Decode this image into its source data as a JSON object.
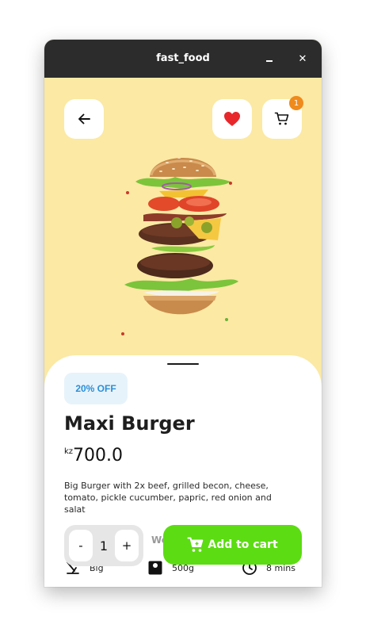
{
  "window": {
    "title": "fast_food"
  },
  "header": {
    "cart_count": "1"
  },
  "product": {
    "discount": "20% OFF",
    "name": "Maxi Burger",
    "currency": "kz",
    "price": "700.0",
    "description": "Big Burger with 2x beef, grilled becon, cheese, tomato, pickle cucumber, papric, red onion and salat",
    "weight_label": "We",
    "specs": {
      "size": "Big",
      "weight": "500g",
      "time": "8 mins"
    }
  },
  "quantity": {
    "minus": "-",
    "value": "1",
    "plus": "+"
  },
  "actions": {
    "add_to_cart": "Add to cart"
  },
  "colors": {
    "hero_bg": "#fbe9a4",
    "accent_green": "#5cdc12",
    "favorite_red": "#e8272b",
    "badge_orange": "#ef8a1c",
    "discount_blue": "#2b8fd6"
  }
}
